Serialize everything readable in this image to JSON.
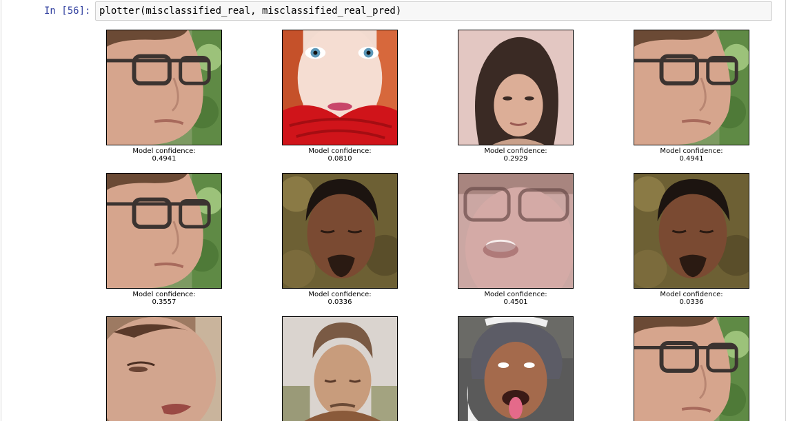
{
  "cell": {
    "prompt": "In [56]:",
    "code": "plotter(misclassified_real, misclassified_real_pred)"
  },
  "output": {
    "caption_label": "Model confidence:",
    "images": [
      {
        "subject": "man-glasses-profile",
        "confidence": "0.4941"
      },
      {
        "subject": "woman-red-scarf",
        "confidence": "0.0810"
      },
      {
        "subject": "woman-long-hair",
        "confidence": "0.2929"
      },
      {
        "subject": "man-glasses-profile",
        "confidence": "0.4941"
      },
      {
        "subject": "man-glasses-profile",
        "confidence": "0.3557"
      },
      {
        "subject": "man-eyes-closed",
        "confidence": "0.0336"
      },
      {
        "subject": "blurry-woman-glasses",
        "confidence": "0.4501"
      },
      {
        "subject": "man-eyes-closed",
        "confidence": "0.0336"
      },
      {
        "subject": "woman-closeup",
        "confidence": ""
      },
      {
        "subject": "man-looking-down",
        "confidence": ""
      },
      {
        "subject": "man-cap-tongue",
        "confidence": ""
      },
      {
        "subject": "man-glasses-profile",
        "confidence": ""
      }
    ]
  }
}
